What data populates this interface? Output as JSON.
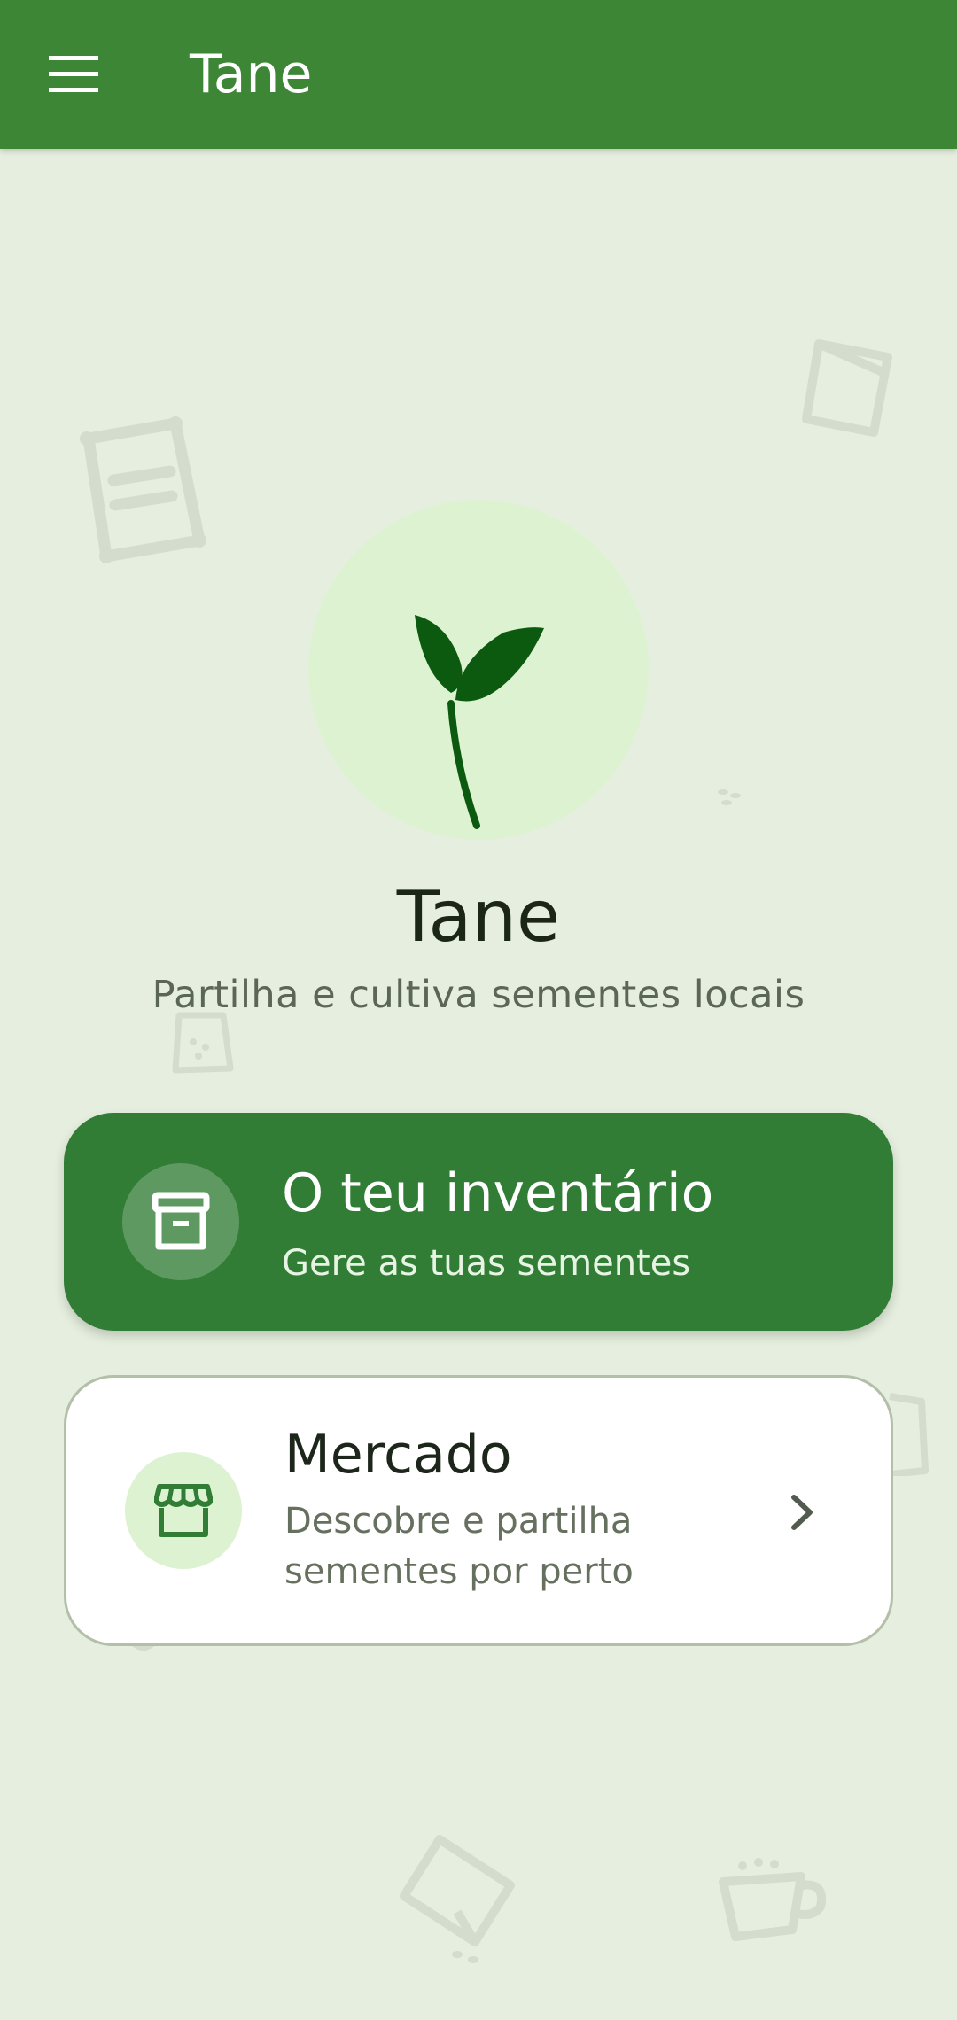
{
  "app_bar": {
    "title": "Tane",
    "menu_icon": "menu-icon"
  },
  "hero": {
    "icon": "sprout-icon",
    "title": "Tane",
    "tagline": "Partilha e cultiva sementes locais"
  },
  "cards": [
    {
      "icon": "archive-box-icon",
      "title": "O teu inventário",
      "subtitle": "Gere as tuas sementes"
    },
    {
      "icon": "storefront-icon",
      "title": "Mercado",
      "subtitle": "Descobre e partilha sementes por perto",
      "trailing_icon": "chevron-right-icon"
    }
  ],
  "colors": {
    "app_bar": "#3c8635",
    "background": "#e6efdf",
    "primary_card": "#317d35",
    "icon_tint": "#ddf2d0",
    "sprout": "#0b5a10"
  }
}
